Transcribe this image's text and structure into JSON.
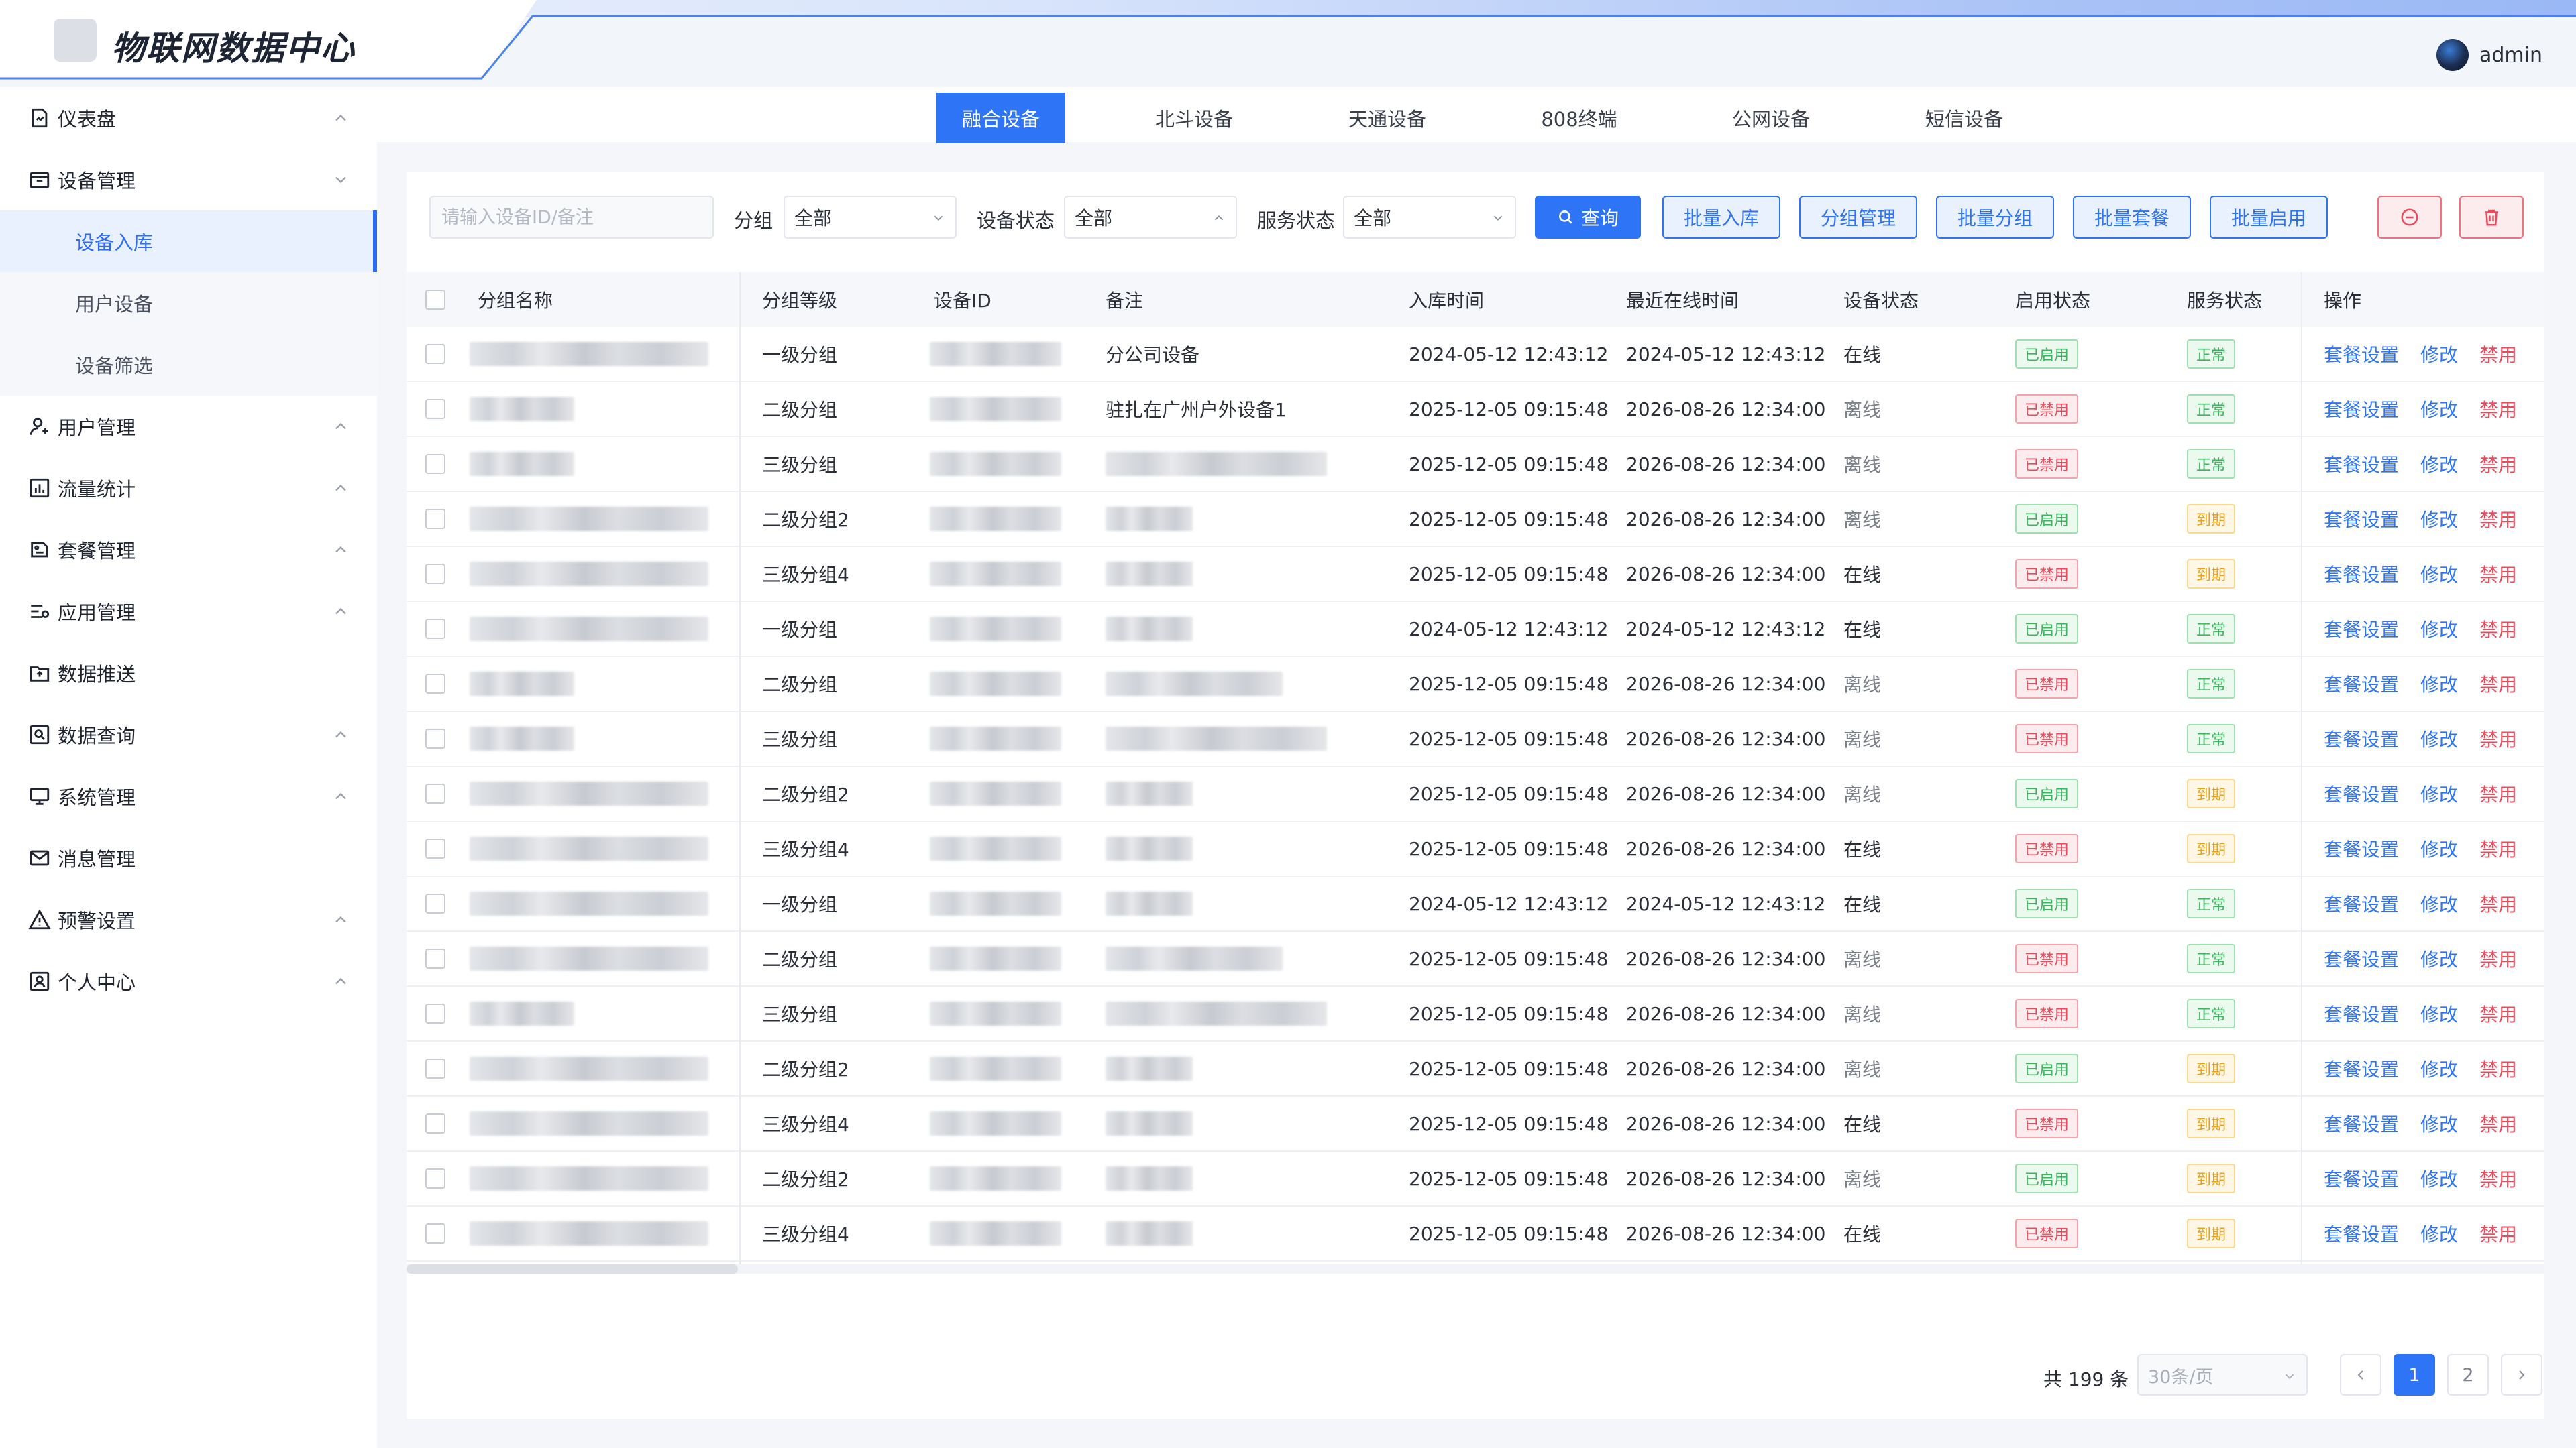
{
  "header": {
    "app_title": "物联网数据中心",
    "username": "admin"
  },
  "sidebar": {
    "items": [
      {
        "label": "仪表盘",
        "icon": "dashboard-icon"
      },
      {
        "label": "设备管理",
        "icon": "device-management-icon",
        "expanded": true,
        "children": [
          {
            "label": "设备入库",
            "active": true
          },
          {
            "label": "用户设备"
          },
          {
            "label": "设备筛选"
          }
        ]
      },
      {
        "label": "用户管理",
        "icon": "user-icon"
      },
      {
        "label": "流量统计",
        "icon": "chart-icon"
      },
      {
        "label": "套餐管理",
        "icon": "package-icon"
      },
      {
        "label": "应用管理",
        "icon": "app-icon"
      },
      {
        "label": "数据推送",
        "icon": "push-icon"
      },
      {
        "label": "数据查询",
        "icon": "query-icon"
      },
      {
        "label": "系统管理",
        "icon": "monitor-icon"
      },
      {
        "label": "消息管理",
        "icon": "message-icon"
      },
      {
        "label": "预警设置",
        "icon": "warning-icon"
      },
      {
        "label": "个人中心",
        "icon": "profile-icon"
      }
    ]
  },
  "tabs": [
    {
      "label": "融合设备",
      "active": true
    },
    {
      "label": "北斗设备"
    },
    {
      "label": "天通设备"
    },
    {
      "label": "808终端"
    },
    {
      "label": "公网设备"
    },
    {
      "label": "短信设备"
    }
  ],
  "filters": {
    "search_placeholder": "请输入设备ID/备注",
    "group_label": "分组",
    "group_value": "全部",
    "device_status_label": "设备状态",
    "device_status_value": "全部",
    "service_status_label": "服务状态",
    "service_status_value": "全部",
    "query_label": "查询",
    "batch_in_label": "批量入库",
    "group_manage_label": "分组管理",
    "batch_group_label": "批量分组",
    "batch_package_label": "批量套餐",
    "batch_enable_label": "批量启用"
  },
  "table": {
    "columns": [
      "分组名称",
      "分组等级",
      "设备ID",
      "备注",
      "入库时间",
      "最近在线时间",
      "设备状态",
      "启用状态",
      "服务状态",
      "操作"
    ],
    "actions": {
      "package": "套餐设置",
      "edit": "修改",
      "disable": "禁用"
    },
    "rows": [
      {
        "level": "一级分组",
        "remark": "分公司设备",
        "in_time": "2024-05-12 12:43:12",
        "last_online": "2024-05-12 12:43:12",
        "device_status": "在线",
        "enable": "已启用",
        "service": "正常"
      },
      {
        "level": "二级分组",
        "remark": "驻扎在广州户外设备1",
        "in_time": "2025-12-05 09:15:48",
        "last_online": "2026-08-26 12:34:00",
        "device_status": "离线",
        "enable": "已禁用",
        "service": "正常"
      },
      {
        "level": "三级分组",
        "remark": "",
        "in_time": "2025-12-05 09:15:48",
        "last_online": "2026-08-26 12:34:00",
        "device_status": "离线",
        "enable": "已禁用",
        "service": "正常"
      },
      {
        "level": "二级分组2",
        "remark": "",
        "in_time": "2025-12-05 09:15:48",
        "last_online": "2026-08-26 12:34:00",
        "device_status": "离线",
        "enable": "已启用",
        "service": "到期"
      },
      {
        "level": "三级分组4",
        "remark": "",
        "in_time": "2025-12-05 09:15:48",
        "last_online": "2026-08-26 12:34:00",
        "device_status": "在线",
        "enable": "已禁用",
        "service": "到期"
      },
      {
        "level": "一级分组",
        "remark": "",
        "in_time": "2024-05-12 12:43:12",
        "last_online": "2024-05-12 12:43:12",
        "device_status": "在线",
        "enable": "已启用",
        "service": "正常"
      },
      {
        "level": "二级分组",
        "remark": "",
        "in_time": "2025-12-05 09:15:48",
        "last_online": "2026-08-26 12:34:00",
        "device_status": "离线",
        "enable": "已禁用",
        "service": "正常"
      },
      {
        "level": "三级分组",
        "remark": "",
        "in_time": "2025-12-05 09:15:48",
        "last_online": "2026-08-26 12:34:00",
        "device_status": "离线",
        "enable": "已禁用",
        "service": "正常"
      },
      {
        "level": "二级分组2",
        "remark": "",
        "in_time": "2025-12-05 09:15:48",
        "last_online": "2026-08-26 12:34:00",
        "device_status": "离线",
        "enable": "已启用",
        "service": "到期"
      },
      {
        "level": "三级分组4",
        "remark": "",
        "in_time": "2025-12-05 09:15:48",
        "last_online": "2026-08-26 12:34:00",
        "device_status": "在线",
        "enable": "已禁用",
        "service": "到期"
      },
      {
        "level": "一级分组",
        "remark": "",
        "in_time": "2024-05-12 12:43:12",
        "last_online": "2024-05-12 12:43:12",
        "device_status": "在线",
        "enable": "已启用",
        "service": "正常"
      },
      {
        "level": "二级分组",
        "remark": "",
        "in_time": "2025-12-05 09:15:48",
        "last_online": "2026-08-26 12:34:00",
        "device_status": "离线",
        "enable": "已禁用",
        "service": "正常"
      },
      {
        "level": "三级分组",
        "remark": "",
        "in_time": "2025-12-05 09:15:48",
        "last_online": "2026-08-26 12:34:00",
        "device_status": "离线",
        "enable": "已禁用",
        "service": "正常"
      },
      {
        "level": "二级分组2",
        "remark": "",
        "in_time": "2025-12-05 09:15:48",
        "last_online": "2026-08-26 12:34:00",
        "device_status": "离线",
        "enable": "已启用",
        "service": "到期"
      },
      {
        "level": "三级分组4",
        "remark": "",
        "in_time": "2025-12-05 09:15:48",
        "last_online": "2026-08-26 12:34:00",
        "device_status": "在线",
        "enable": "已禁用",
        "service": "到期"
      },
      {
        "level": "二级分组2",
        "remark": "",
        "in_time": "2025-12-05 09:15:48",
        "last_online": "2026-08-26 12:34:00",
        "device_status": "离线",
        "enable": "已启用",
        "service": "到期"
      },
      {
        "level": "三级分组4",
        "remark": "",
        "in_time": "2025-12-05 09:15:48",
        "last_online": "2026-08-26 12:34:00",
        "device_status": "在线",
        "enable": "已禁用",
        "service": "到期"
      }
    ]
  },
  "pagination": {
    "total_label": "共 199 条",
    "page_size": "30条/页",
    "pages": [
      "1",
      "2"
    ],
    "current": "1"
  },
  "colors": {
    "primary": "#2e74f7",
    "danger": "#ec4a5b",
    "success": "#3bb65e",
    "warning": "#e8a21b"
  }
}
